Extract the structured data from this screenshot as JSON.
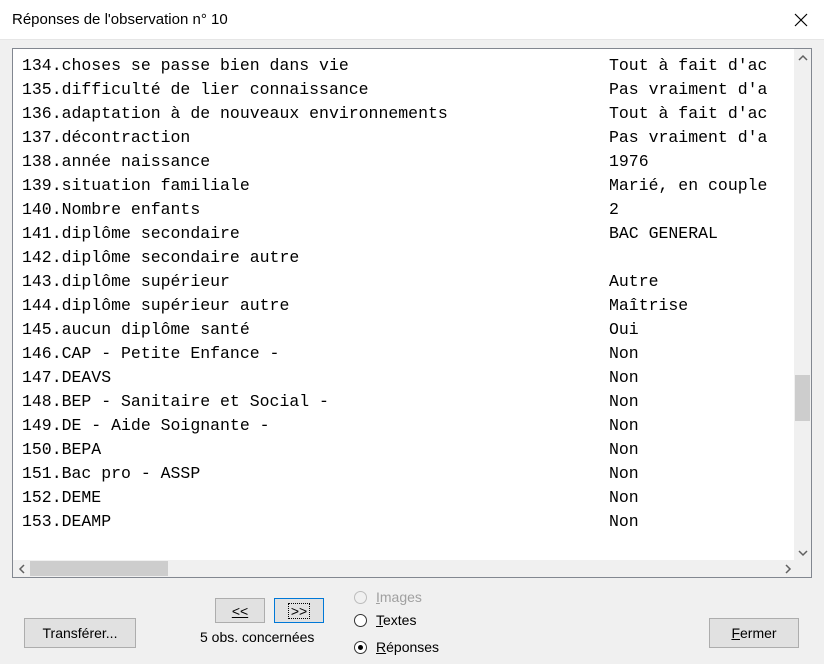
{
  "window": {
    "title": "Réponses de l'observation n° 10"
  },
  "rows": [
    {
      "q": "134.choses se passe bien dans vie",
      "a": "Tout à fait d'ac"
    },
    {
      "q": "135.difficulté de lier connaissance",
      "a": "Pas vraiment d'a"
    },
    {
      "q": "136.adaptation à de nouveaux environnements",
      "a": "Tout à fait d'ac"
    },
    {
      "q": "137.décontraction",
      "a": "Pas vraiment d'a"
    },
    {
      "q": "138.année naissance",
      "a": "1976"
    },
    {
      "q": "139.situation familiale",
      "a": "Marié, en couple"
    },
    {
      "q": "140.Nombre enfants",
      "a": "2"
    },
    {
      "q": "141.diplôme secondaire",
      "a": "BAC GENERAL"
    },
    {
      "q": "142.diplôme secondaire autre",
      "a": ""
    },
    {
      "q": "143.diplôme supérieur",
      "a": "Autre"
    },
    {
      "q": "144.diplôme supérieur autre",
      "a": "Maîtrise"
    },
    {
      "q": "145.aucun diplôme santé",
      "a": "Oui"
    },
    {
      "q": "146.CAP - Petite Enfance -",
      "a": "Non"
    },
    {
      "q": "147.DEAVS",
      "a": "Non"
    },
    {
      "q": "148.BEP - Sanitaire et Social -",
      "a": "Non"
    },
    {
      "q": "149.DE - Aide Soignante -",
      "a": "Non"
    },
    {
      "q": "150.BEPA",
      "a": "Non"
    },
    {
      "q": "151.Bac pro - ASSP",
      "a": "Non"
    },
    {
      "q": "152.DEME",
      "a": "Non"
    },
    {
      "q": "153.DEAMP",
      "a": "Non"
    }
  ],
  "buttons": {
    "transfer": "Transférer...",
    "prev": "<<",
    "next": ">>",
    "close": "Fermer"
  },
  "obs_count": "5 obs. concernées",
  "radio": {
    "images": "Images",
    "texts": "Textes",
    "responses": "Réponses",
    "selected": "responses"
  },
  "icons": {
    "close": "close-icon",
    "scroll_up": "chevron-up-icon",
    "scroll_down": "chevron-down-icon",
    "scroll_left": "chevron-left-icon",
    "scroll_right": "chevron-right-icon"
  },
  "colors": {
    "window_bg": "#f0f0f0",
    "focus_border": "#0078d7",
    "disabled_text": "#a0a0a0"
  }
}
